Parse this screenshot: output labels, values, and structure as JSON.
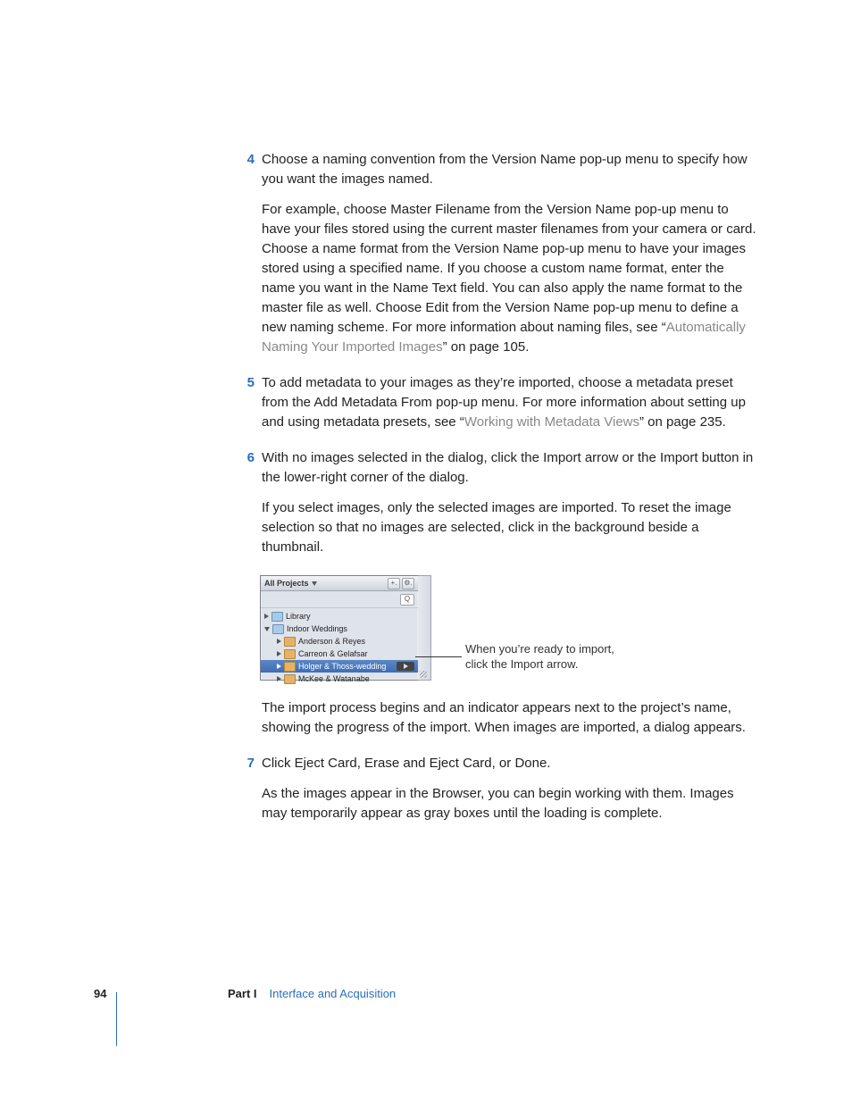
{
  "steps": {
    "s4": {
      "num": "4",
      "p1": "Choose a naming convention from the Version Name pop-up menu to specify how you want the images named.",
      "p2a": "For example, choose Master Filename from the Version Name pop-up menu to have your files stored using the current master filenames from your camera or card. Choose a name format from the Version Name pop-up menu to have your images stored using a specified name. If you choose a custom name format, enter the name you want in the Name Text field. You can also apply the name format to the master file as well. Choose Edit from the Version Name pop-up menu to define a new naming scheme. For more information about naming files, see “",
      "p2link": "Automatically Naming Your Imported Images",
      "p2b": "” on page 105."
    },
    "s5": {
      "num": "5",
      "p1a": "To add metadata to your images as they’re imported, choose a metadata preset from the Add Metadata From pop-up menu. For more information about setting up and using metadata presets, see “",
      "p1link": "Working with Metadata Views",
      "p1b": "” on page 235."
    },
    "s6": {
      "num": "6",
      "p1": "With no images selected in the dialog, click the Import arrow or the Import button in the lower-right corner of the dialog.",
      "p2": "If you select images, only the selected images are imported. To reset the image selection so that no images are selected, click in the background beside a thumbnail.",
      "p3": "The import process begins and an indicator appears next to the project’s name, showing the progress of the import. When images are imported, a dialog appears."
    },
    "s7": {
      "num": "7",
      "p1": "Click Eject Card, Erase and Eject Card, or Done.",
      "p2": "As the images appear in the Browser, you can begin working with them. Images may temporarily appear as gray boxes until the loading is complete."
    }
  },
  "screenshot": {
    "title": "All Projects",
    "btn_add": "+.",
    "btn_gear": "⚙.",
    "search_glyph": "🔍",
    "library": "Library",
    "indoor": "Indoor Weddings",
    "p1": "Anderson & Reyes",
    "p2": "Carreon & Gelafsar",
    "p3": "Holger & Thoss-wedding",
    "p4": "McKee & Watanabe",
    "callout": "When you’re ready to import, click the Import arrow."
  },
  "footer": {
    "page": "94",
    "part_label": "Part I",
    "part_title": "Interface and Acquisition"
  }
}
